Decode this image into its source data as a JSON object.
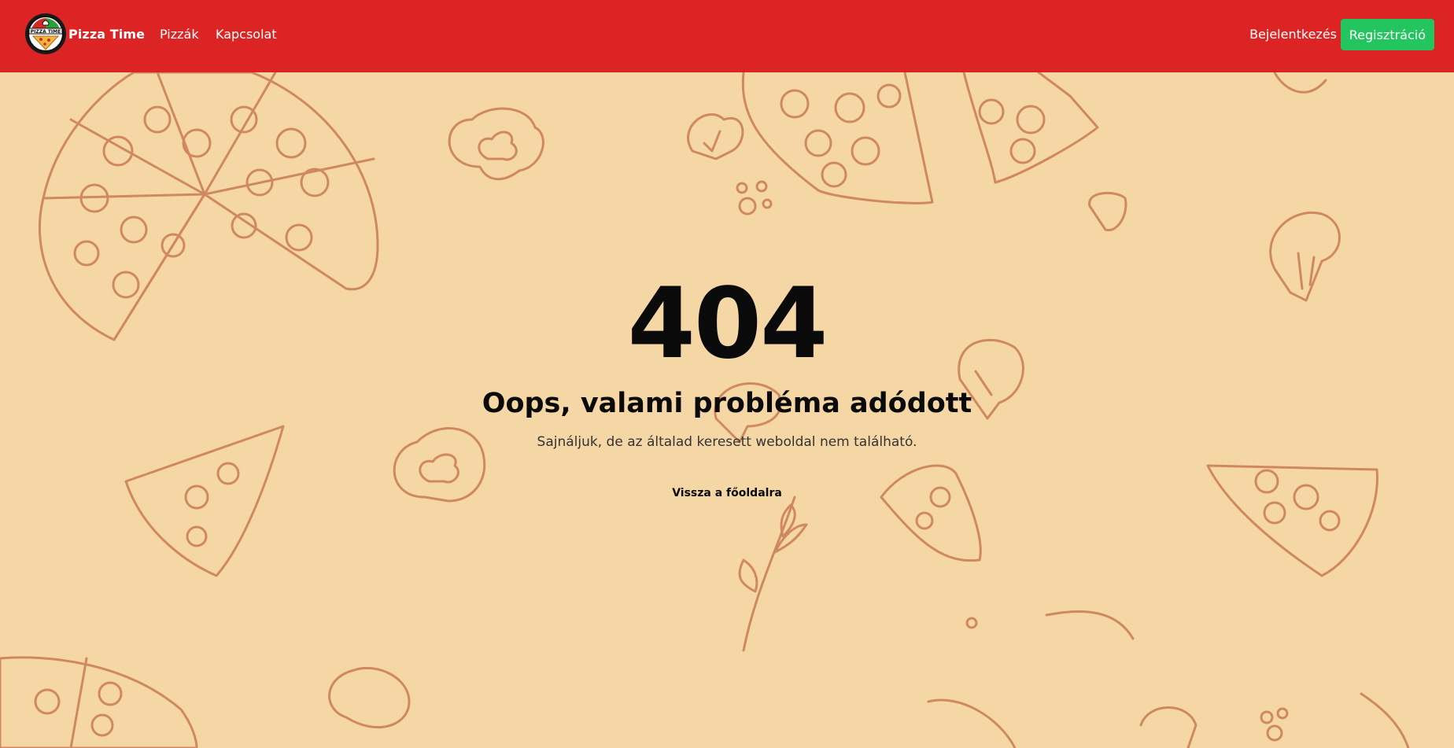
{
  "navbar": {
    "brand_name": "Pizza Time",
    "logo_text": "PIZZA TIME",
    "links": [
      {
        "label": "Pizzák"
      },
      {
        "label": "Kapcsolat"
      }
    ],
    "login_label": "Bejelentkezés",
    "register_label": "Regisztráció"
  },
  "error": {
    "code": "404",
    "title": "Oops, valami probléma adódott",
    "subtitle": "Sajnáljuk, de az általad keresett weboldal nem található.",
    "back_label": "Vissza a főoldalra"
  },
  "colors": {
    "navbar": "#dd2424",
    "register_button": "#22c55e",
    "background": "#f5d7a6",
    "doodle_stroke": "#d08860"
  }
}
